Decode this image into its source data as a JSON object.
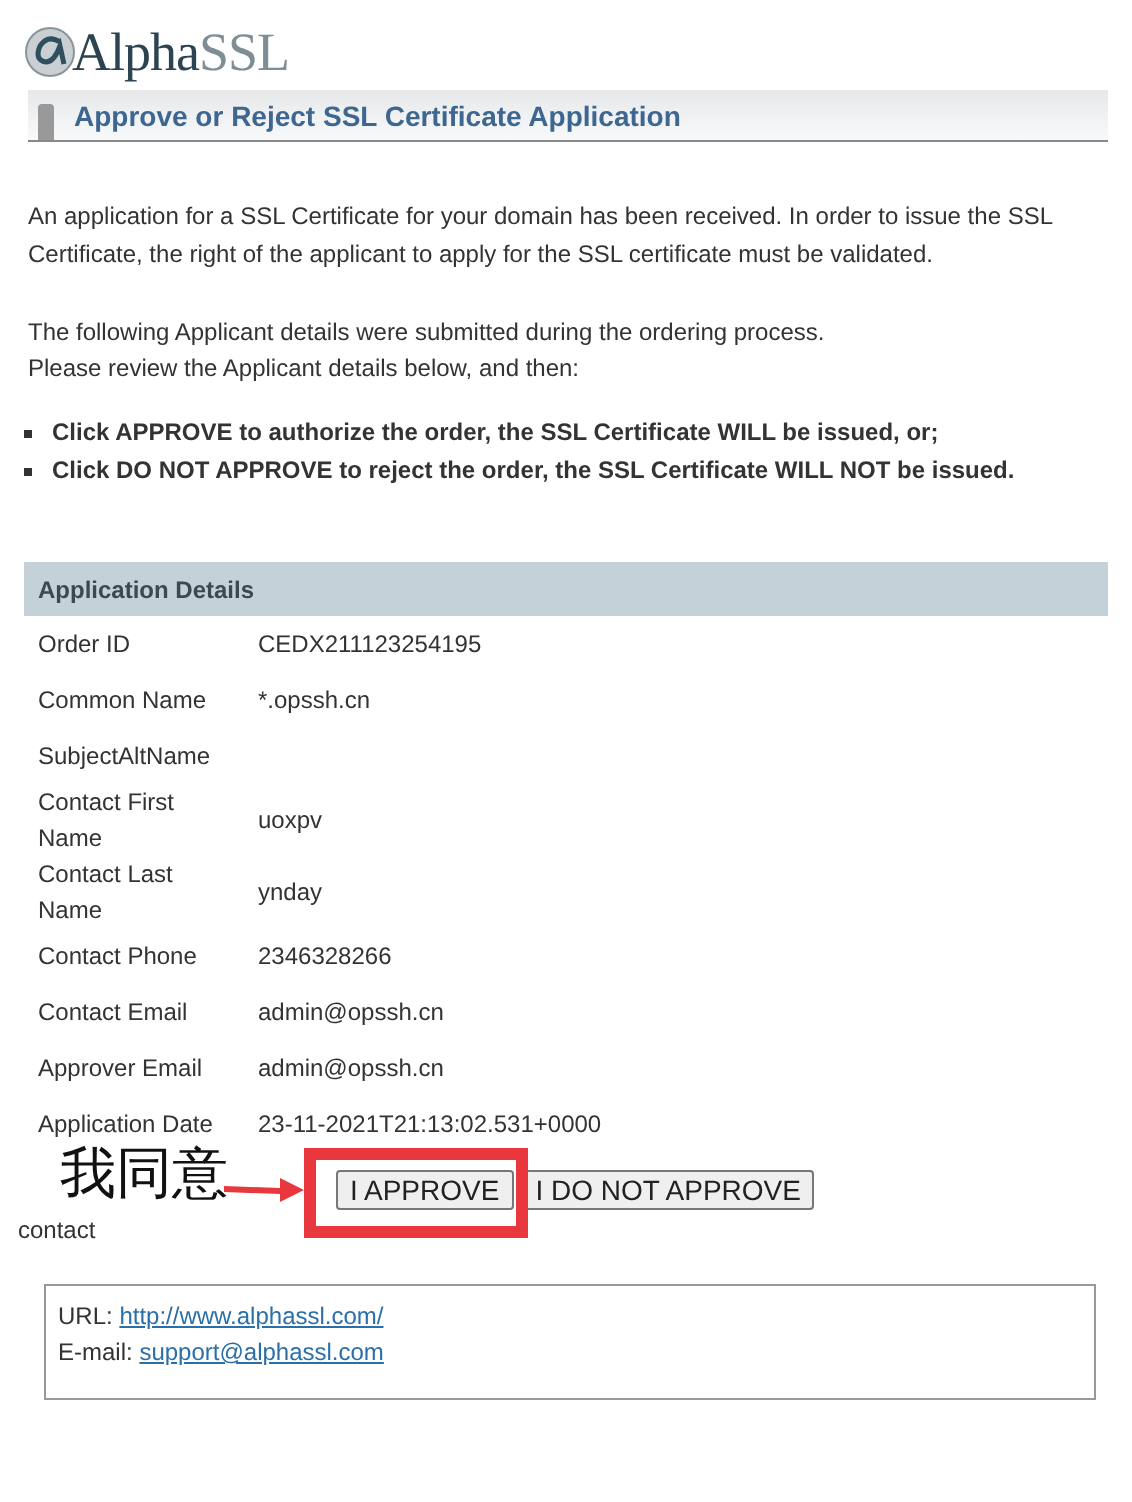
{
  "logo": {
    "part_1": "Alpha",
    "part_2": "SSL"
  },
  "heading": "Approve or Reject SSL Certificate Application",
  "intro": [
    "An application for a SSL Certificate for your domain has been received. In order to issue the SSL Certificate, the right of the applicant to apply for the SSL certificate must be validated.",
    "The following Applicant details were submitted during the ordering process.",
    "Please review the Applicant details below, and then:"
  ],
  "bullets": [
    "Click APPROVE to authorize the order, the SSL Certificate WILL be issued, or;",
    "Click DO NOT APPROVE to reject the order, the SSL Certificate WILL NOT be issued."
  ],
  "details": {
    "title": "Application Details",
    "rows": [
      {
        "label": "Order ID",
        "value": "CEDX211123254195"
      },
      {
        "label": "Common Name",
        "value": "*.opssh.cn"
      },
      {
        "label": "SubjectAltName",
        "value": ""
      },
      {
        "label": "Contact First Name",
        "value": "uoxpv"
      },
      {
        "label": "Contact Last Name",
        "value": "ynday"
      },
      {
        "label": "Contact Phone",
        "value": "2346328266"
      },
      {
        "label": "Contact Email",
        "value": "admin@opssh.cn"
      },
      {
        "label": "Approver Email",
        "value": "admin@opssh.cn"
      },
      {
        "label": "Application Date",
        "value": "23-11-2021T21:13:02.531+0000"
      }
    ]
  },
  "buttons": [
    "I APPROVE",
    "I DO NOT APPROVE"
  ],
  "annotation": "我同意",
  "contact_label": "contact",
  "footer": {
    "url_label": "URL:",
    "url": "http://www.alphassl.com/",
    "email_label": "E-mail:",
    "email": "support@alphassl.com"
  }
}
